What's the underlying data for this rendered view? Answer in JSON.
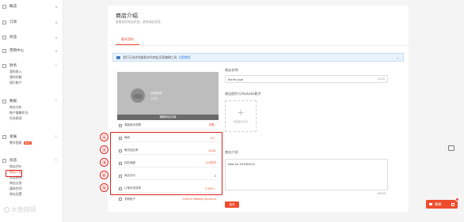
{
  "sidebar": {
    "sections": [
      {
        "title": "概览",
        "items": []
      },
      {
        "title": "订单",
        "items": []
      },
      {
        "title": "商品",
        "items": []
      },
      {
        "title": "营销中心",
        "items": []
      },
      {
        "title": "财务",
        "items": [
          "我的收入",
          "我的余额",
          "银行帐户"
        ]
      },
      {
        "title": "数据",
        "items": [
          "商业分析",
          "帐户健康状况",
          "任务表现"
        ]
      },
      {
        "title": "发展",
        "items": [
          "教学图表"
        ],
        "new_label": "NEW"
      },
      {
        "title": "商店",
        "items": [
          "商店评价",
          "商店介绍",
          "商店装饰",
          "商店分类",
          "媒体空间",
          "商店设置"
        ]
      }
    ]
  },
  "header": {
    "title": "商店介绍",
    "subtitle": "查看您的商店状态，更新商店信息",
    "tab": "基本资料"
  },
  "notice": {
    "text": "我们已改进电脑版本的商店页面编辑工具",
    "link": "立即使用"
  },
  "shop": {
    "cover_button": "编辑商店封面",
    "mobile_label": "电脑版本查看",
    "mobile_link": "查看 ›",
    "name_blur": "店铺名称",
    "name_blur2": "已关注"
  },
  "stats": [
    {
      "num": "①",
      "label": "商品",
      "value": "47 ›"
    },
    {
      "num": "②",
      "label": "聊天回应率",
      "value": "100%"
    },
    {
      "num": "③",
      "label": "回应速度",
      "value": "几小时内"
    },
    {
      "num": "④",
      "label": "商店评价",
      "value": "0"
    },
    {
      "num": "⑤",
      "label": "订单未完成率",
      "value": "0.00% ›"
    },
    {
      "label": "关联帐户",
      "value": "1000% Mobility Account"
    }
  ],
  "form": {
    "name_label": "商店名称",
    "name_value": "fai fai yue",
    "name_count": "10/30",
    "media_label": "商店图片与Youtube影片",
    "upload_text": "添加图片/影片",
    "desc_label": "商店介绍",
    "desc_value": "test on 20190214",
    "desc_count": "16/500",
    "save": "保存"
  },
  "chat": {
    "label": "聊聊",
    "badge": "1"
  },
  "watermark": "大数跨境",
  "colors": {
    "accent": "#ee4d2d",
    "highlight": "#e0211c",
    "notice_bg": "#eaf3fd"
  }
}
